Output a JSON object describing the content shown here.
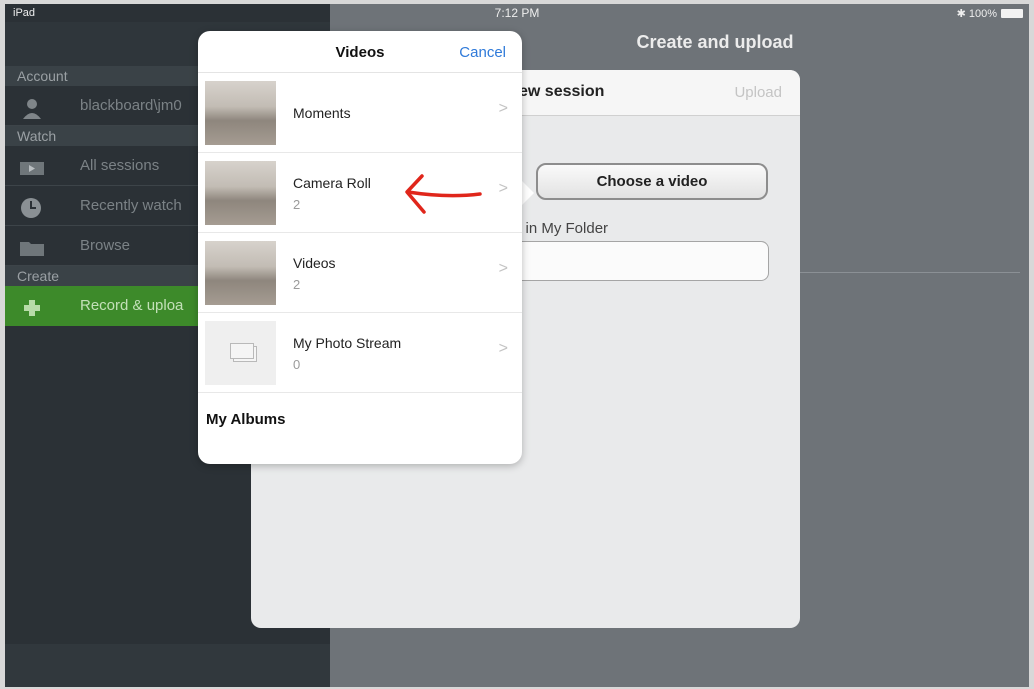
{
  "status_bar": {
    "device": "iPad",
    "time": "7:12 PM",
    "battery": "✱ 100%"
  },
  "sidebar": {
    "sections": [
      {
        "header": "Account"
      },
      {
        "header": "Watch"
      },
      {
        "header": "Create"
      }
    ],
    "items": [
      {
        "label": "blackboard\\jm0",
        "icon": "user-icon"
      },
      {
        "label": "All sessions",
        "icon": "video-icon"
      },
      {
        "label": "Recently watch",
        "icon": "clock-icon"
      },
      {
        "label": "Browse",
        "icon": "folder-icon"
      },
      {
        "label": "Record & uploa",
        "icon": "plus-icon",
        "active": true
      }
    ]
  },
  "main": {
    "title": "Create and upload"
  },
  "card": {
    "title": "ew session",
    "upload_label": "Upload",
    "choose_label": "Choose a video",
    "folder_label": "n in My Folder"
  },
  "popover": {
    "title": "Videos",
    "cancel_label": "Cancel",
    "albums": [
      {
        "name": "Moments",
        "count": ""
      },
      {
        "name": "Camera Roll",
        "count": "2"
      },
      {
        "name": "Videos",
        "count": "2"
      },
      {
        "name": "My Photo Stream",
        "count": "0"
      }
    ],
    "my_albums_label": "My Albums"
  },
  "colors": {
    "annotation_arrow": "#e0261b",
    "accent_link": "#2f7ad9",
    "active_sidebar": "#3d8a2a"
  }
}
